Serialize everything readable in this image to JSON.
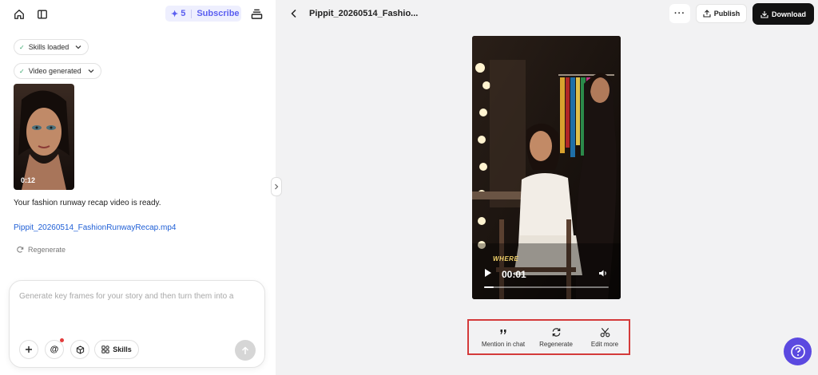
{
  "header": {
    "credits_count": "5",
    "subscribe_label": "Subscribe"
  },
  "chat": {
    "status_chips": [
      {
        "label": "Skills loaded"
      },
      {
        "label": "Video generated"
      }
    ],
    "thumbnail_duration": "0:12",
    "message": "Your fashion runway recap video is ready.",
    "file_link": "Pippit_20260514_FashionRunwayRecap.mp4",
    "regenerate_label": "Regenerate"
  },
  "composer": {
    "placeholder": "Generate key frames for your story and then turn them into a",
    "skills_label": "Skills"
  },
  "preview": {
    "title": "Pippit_20260514_Fashio...",
    "publish_label": "Publish",
    "download_label": "Download",
    "video": {
      "caption": "WHERE",
      "current_time": "00:01",
      "progress": 0.08
    },
    "actions": [
      {
        "label": "Mention in chat",
        "icon": "quote-icon"
      },
      {
        "label": "Regenerate",
        "icon": "refresh-icon"
      },
      {
        "label": "Edit more",
        "icon": "scissors-icon"
      }
    ]
  },
  "colors": {
    "accent": "#5b5ff0",
    "link": "#1f5fd6",
    "download_bg": "#121212",
    "highlight_border": "#d43a3a",
    "help_bg": "#5b49e0"
  }
}
